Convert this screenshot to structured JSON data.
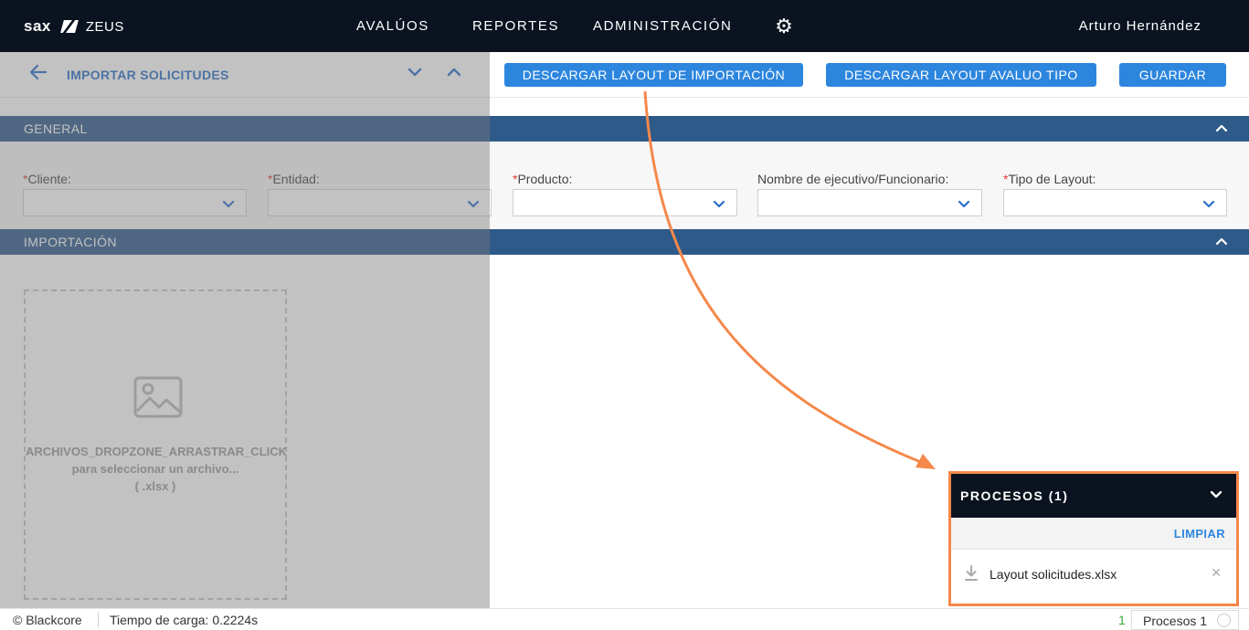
{
  "brand": {
    "logo_text": "sax",
    "product": "ZEUS"
  },
  "nav": {
    "items": [
      "AVALÚOS",
      "REPORTES",
      "ADMINISTRACIÓN"
    ],
    "user": "Arturo Hernández"
  },
  "toolbar": {
    "title": "IMPORTAR SOLICITUDES",
    "download_import_layout": "DESCARGAR LAYOUT DE IMPORTACIÓN",
    "download_appraisal_layout": "DESCARGAR LAYOUT AVALUO TIPO",
    "save": "GUARDAR"
  },
  "sections": {
    "general": "GENERAL",
    "import": "IMPORTACIÓN"
  },
  "fields": [
    {
      "label": "Cliente:",
      "required": true,
      "value": ""
    },
    {
      "label": "Entidad:",
      "required": true,
      "value": ""
    },
    {
      "label": "Producto:",
      "required": true,
      "value": ""
    },
    {
      "label": "Nombre de ejecutivo/Funcionario:",
      "required": false,
      "value": ""
    },
    {
      "label": "Tipo de Layout:",
      "required": true,
      "value": ""
    }
  ],
  "required_mark": "*",
  "dropzone": {
    "line1": "ARCHIVOS_DROPZONE_ARRASTRAR_CLICK",
    "line2": "para seleccionar un archivo...",
    "line3": "( .xlsx )"
  },
  "processes": {
    "title": "PROCESOS (1)",
    "clear": "LIMPIAR",
    "items": [
      {
        "name": "Layout solicitudes.xlsx"
      }
    ]
  },
  "footer": {
    "copyright": "© Blackcore",
    "load_time": "Tiempo de carga: 0.2224s",
    "process_count": "1",
    "process_tab": "Procesos 1"
  },
  "colors": {
    "topbar": "#0b1320",
    "accent": "#2d86de",
    "section_bar": "#2e5a8a",
    "highlight": "#f5884a",
    "required": "#e0393e"
  },
  "icons": {
    "back": "arrow-left-icon",
    "settings": "gear-icon",
    "dropdown": "chevron-down-icon",
    "collapse": "chevron-up-icon",
    "image": "image-icon",
    "download": "download-icon",
    "close": "close-icon"
  }
}
